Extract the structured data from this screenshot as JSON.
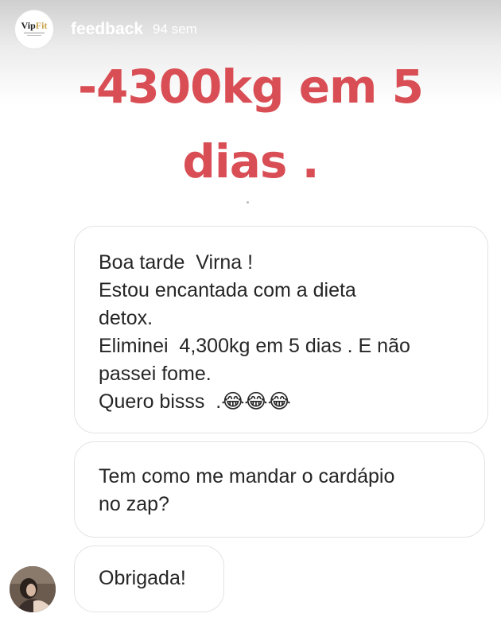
{
  "header": {
    "profile_logo": "VipFit",
    "username": "feedback",
    "timestamp": "94 sem"
  },
  "story_title": [
    "-4300kg em 5",
    "dias ."
  ],
  "messages": [
    {
      "lines": [
        "Boa tarde  Virna !",
        "Estou encantada com a dieta",
        "detox.",
        "Eliminei  4,300kg em 5 dias . E não",
        "passei fome.",
        "Quero bisss  .😂😂😂"
      ]
    },
    {
      "lines": [
        "Tem como me mandar o cardápio",
        "no zap?"
      ]
    },
    {
      "lines": [
        "Obrigada!"
      ]
    }
  ],
  "colors": {
    "title_red": "#d94e55",
    "bubble_border": "#e3e3e3",
    "text": "#262626"
  },
  "icons": {
    "profile": "vipfit-logo-avatar",
    "sender": "sender-avatar-photo",
    "emoji": "face-with-tears-of-joy"
  }
}
